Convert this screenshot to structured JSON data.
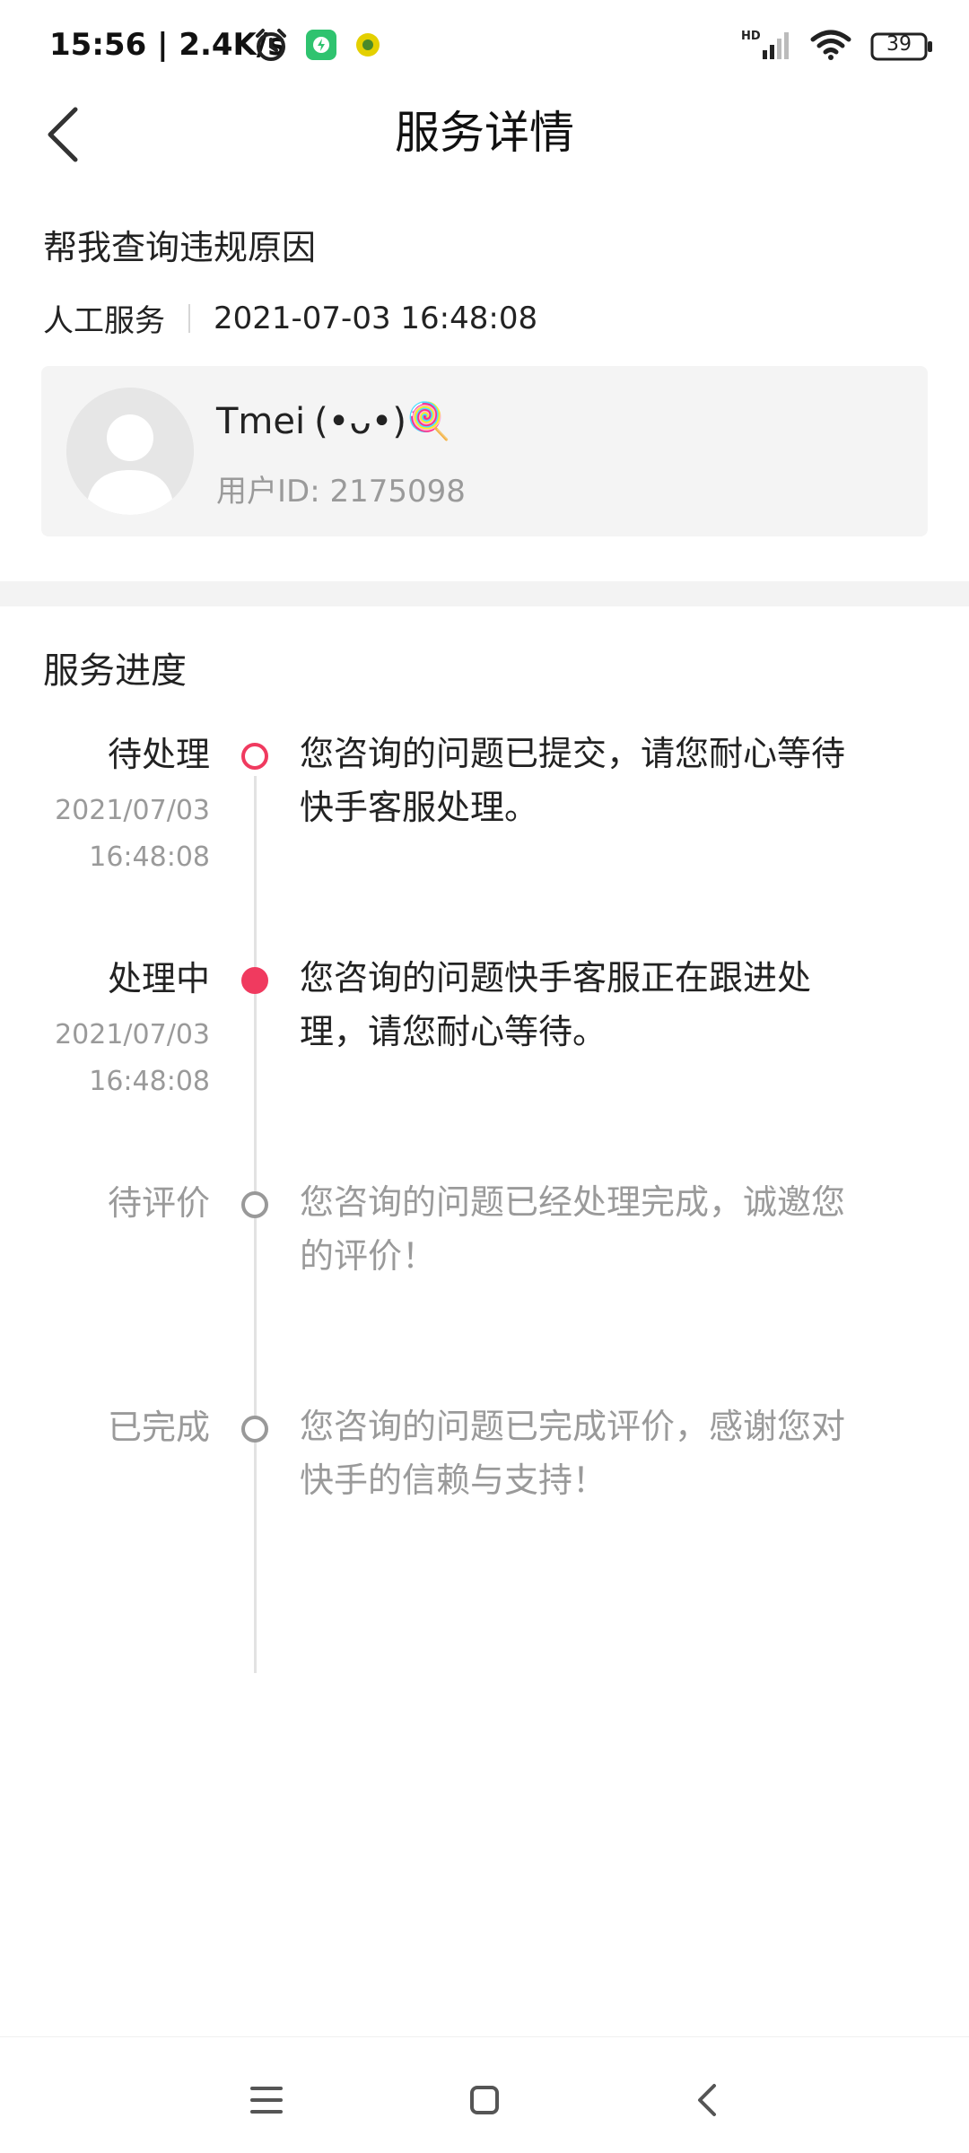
{
  "status_bar": {
    "time_and_speed": "15:56 | 2.4K/s",
    "battery": "39",
    "network_label": "HD",
    "colors": {
      "app_icon_green": "#2fc36f",
      "app_icon_yellow": "#e4d000"
    }
  },
  "header": {
    "title": "服务详情"
  },
  "service": {
    "title": "帮我查询违规原因",
    "type": "人工服务",
    "datetime": "2021-07-03 16:48:08"
  },
  "user": {
    "name": "Tmei",
    "emoticon": "(•ᴗ•)🍭",
    "id_label": "用户ID: 2175098"
  },
  "progress": {
    "title": "服务进度",
    "colors": {
      "accent": "#f03a5f",
      "inactive": "#9a9a9a"
    },
    "steps": [
      {
        "status": "待处理",
        "date": "2021/07/03",
        "time": "16:48:08",
        "desc": "您咨询的问题已提交，请您耐心等待快手客服处理。"
      },
      {
        "status": "处理中",
        "date": "2021/07/03",
        "time": "16:48:08",
        "desc": "您咨询的问题快手客服正在跟进处理，请您耐心等待。"
      },
      {
        "status": "待评价",
        "desc": "您咨询的问题已经处理完成，诚邀您的评价！"
      },
      {
        "status": "已完成",
        "desc": "您咨询的问题已完成评价，感谢您对快手的信赖与支持！"
      }
    ]
  },
  "nav_bar": {
    "icons": [
      "menu-icon",
      "home-icon",
      "back-icon"
    ]
  }
}
